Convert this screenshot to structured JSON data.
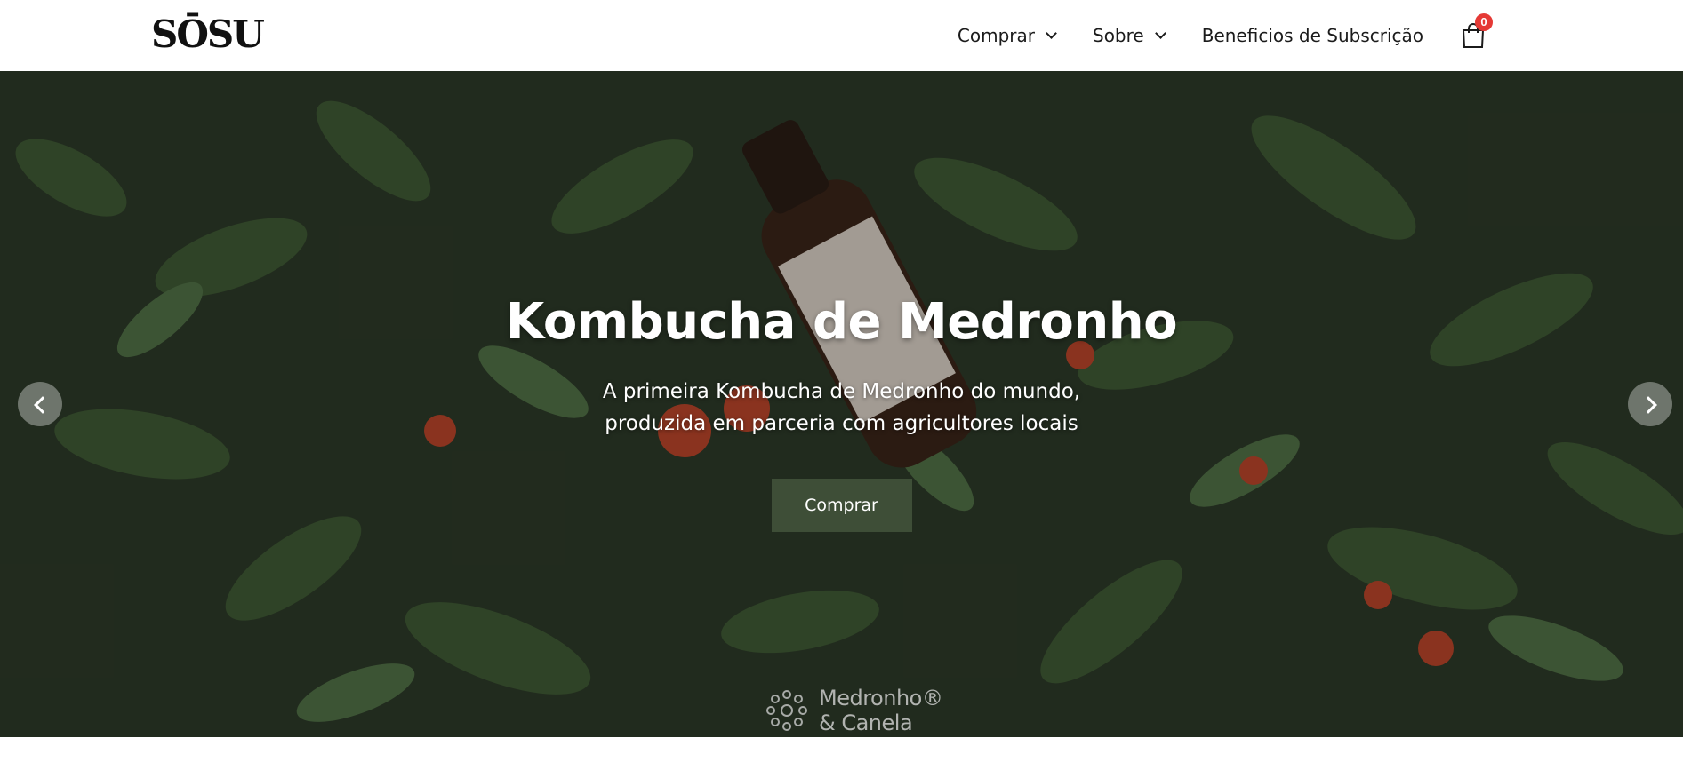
{
  "header": {
    "logo": "SŌSU",
    "nav": [
      {
        "label": "Comprar",
        "has_dropdown": true
      },
      {
        "label": "Sobre",
        "has_dropdown": true
      },
      {
        "label": "Beneficios de Subscrição",
        "has_dropdown": false
      }
    ],
    "cart_count": "0"
  },
  "hero": {
    "title": "Kombucha de Medronho",
    "subtitle_line1": "A primeira Kombucha de Medronho do mundo,",
    "subtitle_line2": "produzida em parceria com agricultores locais",
    "button_label": "Comprar",
    "watermark_line1": "Medronho®",
    "watermark_line2": "& Canela",
    "prev_icon": "chevron-left-icon",
    "next_icon": "chevron-right-icon"
  },
  "colors": {
    "button_bg": "#3e4e37",
    "badge": "#e53935",
    "foliage": "#2b3526"
  }
}
